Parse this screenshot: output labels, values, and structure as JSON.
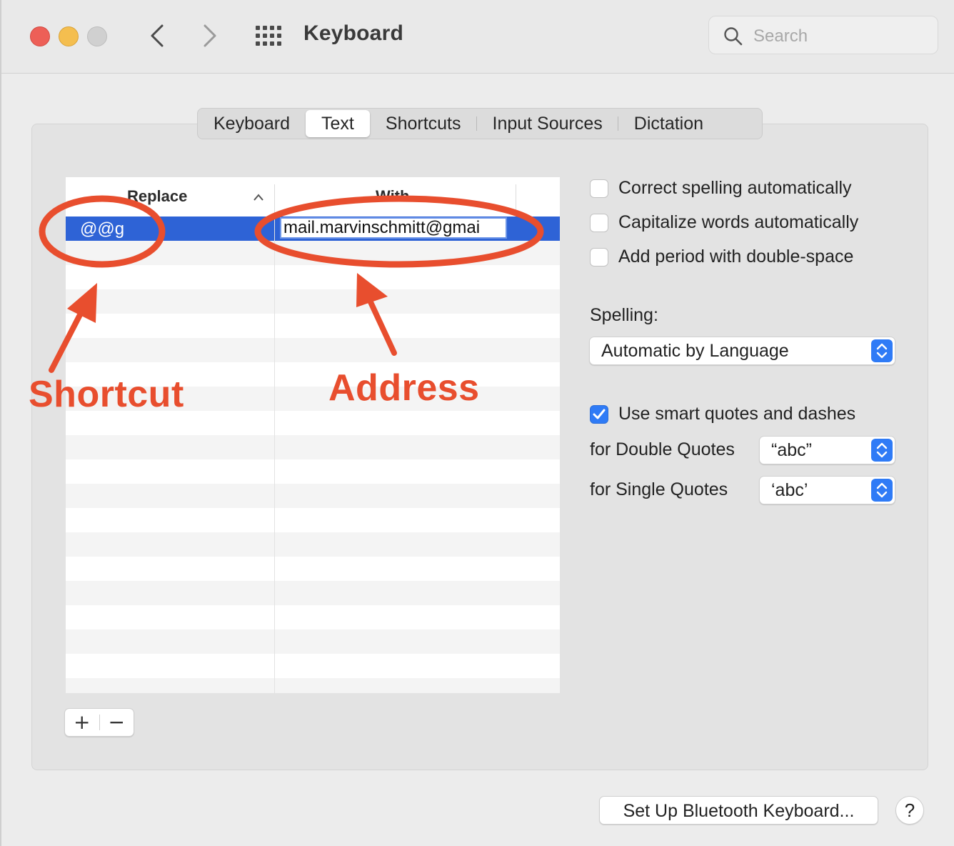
{
  "window": {
    "title": "Keyboard"
  },
  "search": {
    "placeholder": "Search"
  },
  "tabs": [
    {
      "label": "Keyboard"
    },
    {
      "label": "Text"
    },
    {
      "label": "Shortcuts"
    },
    {
      "label": "Input Sources"
    },
    {
      "label": "Dictation"
    }
  ],
  "table": {
    "headers": {
      "replace": "Replace",
      "with": "With"
    },
    "rows": [
      {
        "replace": "@@g",
        "with": "mail.marvinschmitt@gmai"
      }
    ]
  },
  "controls": {
    "add": "+",
    "remove": "−"
  },
  "options": {
    "correct_spelling": "Correct spelling automatically",
    "capitalize": "Capitalize words automatically",
    "add_period": "Add period with double-space",
    "smart_quotes": "Use smart quotes and dashes"
  },
  "spelling": {
    "label": "Spelling:",
    "value": "Automatic by Language"
  },
  "double_quotes": {
    "label": "for Double Quotes",
    "value": "“abc”"
  },
  "single_quotes": {
    "label": "for Single Quotes",
    "value": "‘abc’"
  },
  "footer": {
    "bluetooth": "Set Up Bluetooth Keyboard...",
    "help": "?"
  },
  "annotations": {
    "shortcut": "Shortcut",
    "address": "Address",
    "color": "#e84e2e"
  },
  "colors": {
    "accent": "#2f7bf6",
    "selection": "#2e63d6"
  }
}
